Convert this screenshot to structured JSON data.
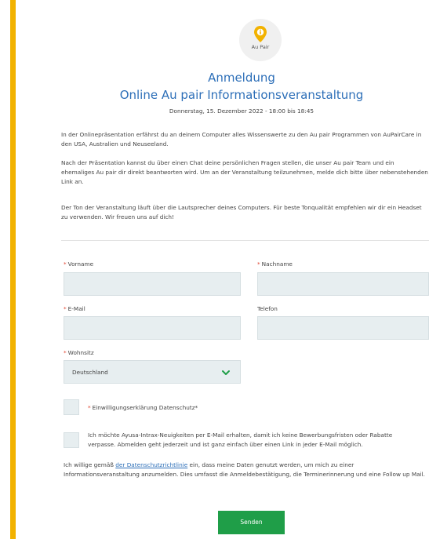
{
  "header": {
    "badge_label": "Au Pair",
    "title_line1": "Anmeldung",
    "title_line2": "Online Au pair Informationsveranstaltung",
    "date": "Donnerstag, 15. Dezember 2022 - 18:00 bis 18:45"
  },
  "intro": {
    "p1": "In der Onlinepräsentation erfährst du an deinem Computer alles Wissenswerte zu den Au pair Programmen von AuPairCare in den USA, Australien und Neuseeland.",
    "p2": "Nach der Präsentation kannst du über einen Chat deine persönlichen Fragen stellen, die unser Au pair Team und ein ehemaliges Au pair dir direkt beantworten wird. Um an der Veranstaltung teilzunehmen, melde dich bitte über nebenstehenden Link an.",
    "p3": "Der Ton der Veranstaltung läuft über die Lautsprecher deines Computers. Für beste Tonqualität empfehlen wir dir ein Headset zu verwenden. Wir freuen uns auf dich!"
  },
  "form": {
    "required_mark": "*",
    "vorname_label": "Vorname",
    "nachname_label": "Nachname",
    "email_label": "E-Mail",
    "telefon_label": "Telefon",
    "wohnsitz_label": "Wohnsitz",
    "wohnsitz_value": "Deutschland",
    "privacy_checkbox_label": "Einwilligungserklärung Datenschutz*",
    "newsletter_checkbox_label": "Ich möchte Ayusa-Intrax-Neuigkeiten per E-Mail erhalten, damit ich keine Bewerbungsfristen oder Rabatte verpasse. Abmelden geht jederzeit und ist ganz einfach über einen Link in jeder E-Mail möglich.",
    "consent_prefix": "Ich willige gemäß ",
    "consent_link": "der Datenschutzrichtlinie",
    "consent_suffix": " ein, dass meine Daten genutzt werden, um mich zu einer Informationsveranstaltung anzumelden. Dies umfasst die Anmeldebestätigung, die Terminerinnerung und eine Follow up Mail.",
    "submit_label": "Senden"
  },
  "colors": {
    "accent": "#f2b200",
    "heading": "#2d6fb8",
    "submit": "#1f9e48",
    "required": "#e0412c"
  },
  "icons": {
    "badge": "location-pin-info-icon",
    "select": "chevron-down-icon"
  }
}
